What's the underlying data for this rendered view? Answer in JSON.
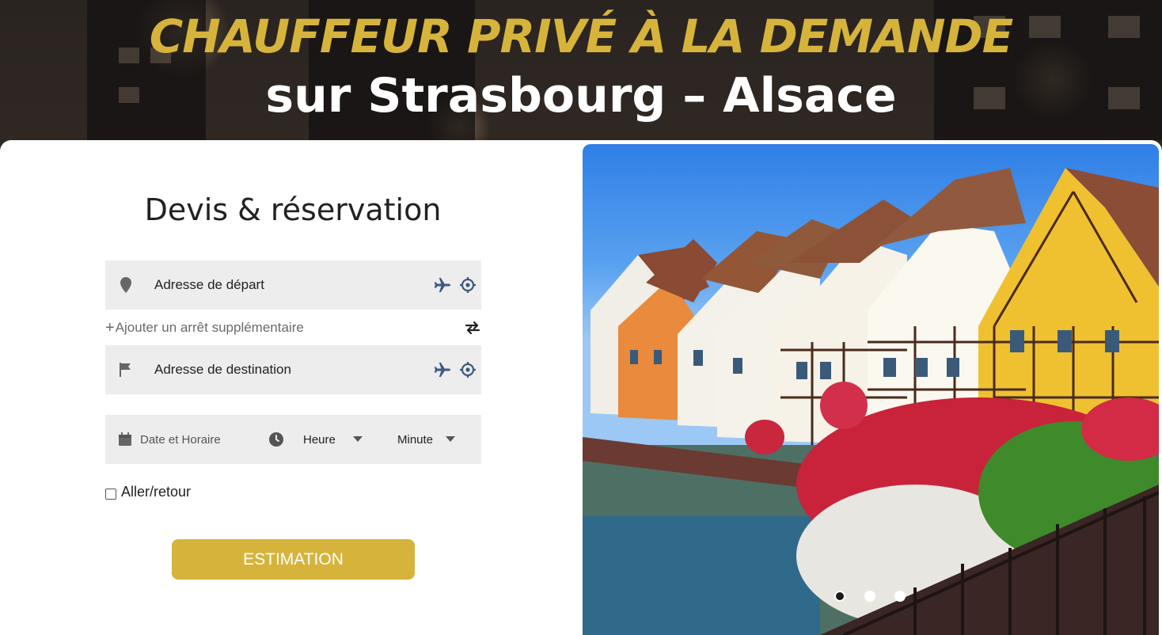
{
  "hero": {
    "title": "CHAUFFEUR PRIVÉ À LA DEMANDE",
    "subtitle": "sur Strasbourg – Alsace"
  },
  "form": {
    "title": "Devis & réservation",
    "departure_label": "Adresse de départ",
    "add_stop_label": "Ajouter un arrêt supplémentaire",
    "destination_label": "Adresse de destination",
    "date_label": "Date et Horaire",
    "hour_label": "Heure",
    "minute_label": "Minute",
    "roundtrip_label": "Aller/retour",
    "estimate_button": "ESTIMATION"
  },
  "carousel": {
    "slides": 3,
    "active_index": 0
  },
  "colors": {
    "accent_gold": "#d6b43c",
    "icon_blue": "#3d5a80",
    "field_bg": "#ededed"
  },
  "icons": {
    "departure": "map-pin-icon",
    "destination": "flag-icon",
    "airport": "airplane-icon",
    "locate": "crosshair-icon",
    "swap": "swap-arrows-icon",
    "calendar": "calendar-icon",
    "clock": "clock-icon",
    "dropdown": "caret-down-icon"
  }
}
